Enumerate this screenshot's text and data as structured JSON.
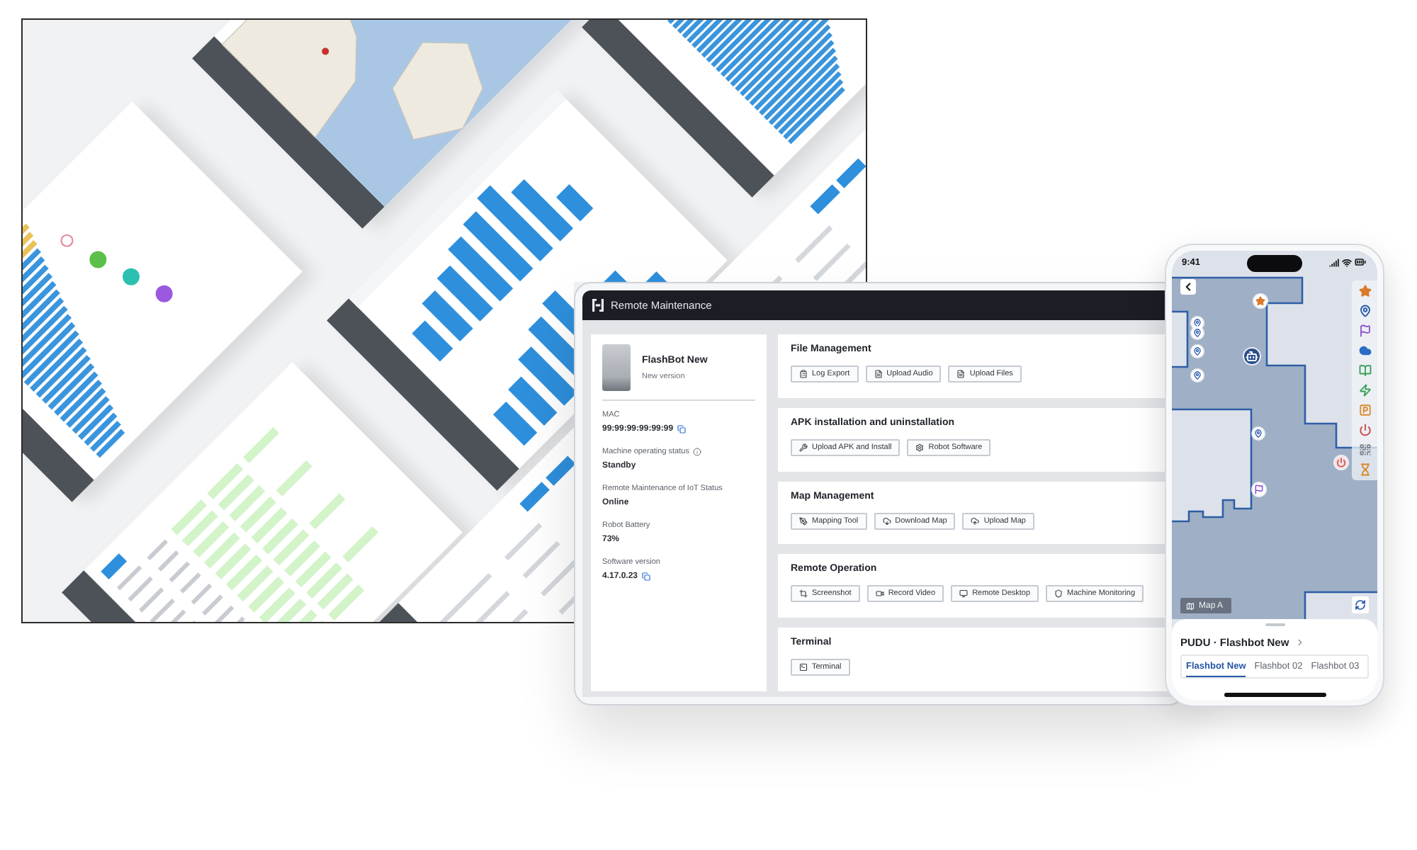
{
  "tablet": {
    "title": "Remote Maintenance",
    "robot": {
      "name": "FlashBot New",
      "note": "New version"
    },
    "fields": [
      {
        "label": "MAC",
        "value": "99:99:99:99:99:99",
        "info": false,
        "copy": true
      },
      {
        "label": "Machine operating status",
        "value": "Standby",
        "info": true,
        "copy": false
      },
      {
        "label": "Remote Maintenance of IoT Status",
        "value": "Online",
        "info": false,
        "copy": false
      },
      {
        "label": "Robot Battery",
        "value": "73%",
        "info": false,
        "copy": false
      },
      {
        "label": "Software version",
        "value": "4.17.0.23",
        "info": false,
        "copy": true
      }
    ],
    "sections": [
      {
        "title": "File Management",
        "buttons": [
          "Log Export",
          "Upload Audio",
          "Upload Files"
        ]
      },
      {
        "title": "APK installation and uninstallation",
        "buttons": [
          "Upload APK and Install",
          "Robot Software"
        ]
      },
      {
        "title": "Map Management",
        "buttons": [
          "Mapping Tool",
          "Download Map",
          "Upload Map"
        ]
      },
      {
        "title": "Remote Operation",
        "buttons": [
          "Screenshot",
          "Record Video",
          "Remote Desktop",
          "Machine Monitoring"
        ]
      },
      {
        "title": "Terminal",
        "buttons": [
          "Terminal"
        ]
      }
    ]
  },
  "phone": {
    "time": "9:41",
    "map_label": "Map A",
    "robot_title": "PUDU · Flashbot New",
    "tabs": [
      {
        "label": "Flashbot New",
        "selected": true
      },
      {
        "label": "Flashbot 02",
        "selected": false
      },
      {
        "label": "Flashbot 03",
        "selected": false
      }
    ]
  }
}
